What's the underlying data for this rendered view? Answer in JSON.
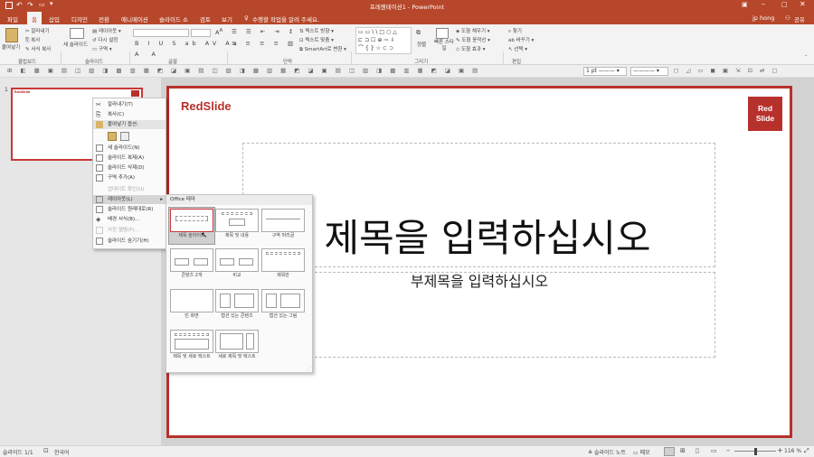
{
  "window": {
    "title": "프레젠테이션1 - PowerPoint"
  },
  "tabs": [
    {
      "label": "파일"
    },
    {
      "label": "홈"
    },
    {
      "label": "삽입"
    },
    {
      "label": "디자인"
    },
    {
      "label": "전환"
    },
    {
      "label": "애니메이션"
    },
    {
      "label": "슬라이드 쇼"
    },
    {
      "label": "검토"
    },
    {
      "label": "보기"
    }
  ],
  "tellme": "수행할 작업을 알려 주세요.",
  "user": {
    "name": "jp hong",
    "share": "공유"
  },
  "ribbon": {
    "paste": "붙여넣기",
    "cut": "잘라내기",
    "copy": "복사",
    "format_painter": "서식 복사",
    "new_slide": "새 슬라이드",
    "layout": "레이아웃",
    "reset": "다시 설정",
    "section": "구역",
    "text_direction": "텍스트 방향",
    "align_text": "텍스트 맞춤",
    "smartart": "SmartArt로 변환",
    "arrange": "정렬",
    "quick_styles": "빠른 스타일",
    "shape_fill": "도형 채우기",
    "shape_outline": "도형 윤곽선",
    "shape_effects": "도형 효과",
    "find": "찾기",
    "replace": "바꾸기",
    "select": "선택",
    "groups": [
      "클립보드",
      "슬라이드",
      "글꼴",
      "단락",
      "그리기",
      "편집"
    ]
  },
  "qat": {
    "line_weight": "1 pt"
  },
  "slide": {
    "number": "1",
    "logo_text": "RedSlide",
    "badge_line1": "Red",
    "badge_line2": "Slide",
    "title_placeholder": "제목을 입력하십시오",
    "subtitle_placeholder": "부제목을 입력하십시오",
    "thumb_logo": "RedSlide"
  },
  "context_menu": {
    "items": [
      {
        "label": "잘라내기(T)"
      },
      {
        "label": "복사(C)"
      },
      {
        "label": "붙여넣기 옵션:"
      },
      {
        "label": "새 슬라이드(N)"
      },
      {
        "label": "슬라이드 복제(A)"
      },
      {
        "label": "슬라이드 삭제(D)"
      },
      {
        "label": "구역 추가(A)"
      },
      {
        "label": "업데이트 확인(U)"
      },
      {
        "label": "레이아웃(L)"
      },
      {
        "label": "슬라이드 원래대로(R)"
      },
      {
        "label": "배경 서식(B)..."
      },
      {
        "label": "사진 앨범(P)..."
      },
      {
        "label": "슬라이드 숨기기(H)"
      }
    ]
  },
  "layout_menu": {
    "header": "Office 테마",
    "layouts": [
      {
        "label": "제목 슬라이드"
      },
      {
        "label": "제목 및 내용"
      },
      {
        "label": "구역 머리글"
      },
      {
        "label": "콘텐츠 2개"
      },
      {
        "label": "비교"
      },
      {
        "label": "제목만"
      },
      {
        "label": "빈 화면"
      },
      {
        "label": "캡션 있는 콘텐츠"
      },
      {
        "label": "캡션 있는 그림"
      },
      {
        "label": "제목 및 세로 텍스트"
      },
      {
        "label": "세로 제목 및 텍스트"
      }
    ]
  },
  "statusbar": {
    "slide_info": "슬라이드 1/1",
    "language": "한국어",
    "notes": "슬라이드 노트",
    "comments": "메모",
    "zoom": "116 %"
  },
  "colors": {
    "brand": "#b7472a",
    "slide_red": "#b7312c"
  }
}
